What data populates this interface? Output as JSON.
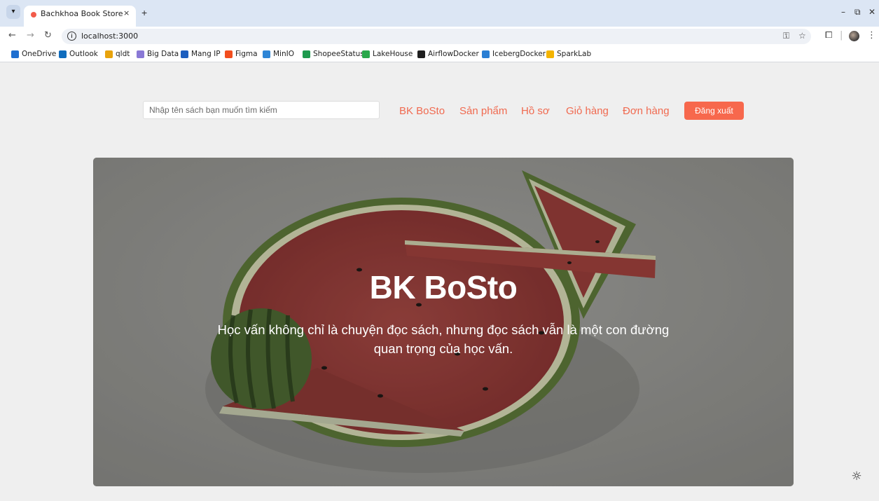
{
  "browser": {
    "tab_title": "Bachkhoa Book Store",
    "tab_close": "×",
    "new_tab": "+",
    "url": "localhost:3000",
    "bookmarks": [
      {
        "label": "OneDrive",
        "icon": "onedrive-icon",
        "color": "#1e6fd0"
      },
      {
        "label": "Outlook",
        "icon": "outlook-icon",
        "color": "#0f6cbd"
      },
      {
        "label": "qldt",
        "icon": "qldt-icon",
        "color": "#e8a30c"
      },
      {
        "label": "Big Data",
        "icon": "spark-icon",
        "color": "#8a79d6"
      },
      {
        "label": "Mang IP",
        "icon": "mangip-icon",
        "color": "#1d5fbf"
      },
      {
        "label": "Figma",
        "icon": "figma-icon",
        "color": "#f24e1e"
      },
      {
        "label": "MinIO",
        "icon": "minio-icon",
        "color": "#2f86d6"
      },
      {
        "label": "ShopeeStatus",
        "icon": "sheets-icon",
        "color": "#1e9a4e"
      },
      {
        "label": "LakeHouse",
        "icon": "lakehouse-icon",
        "color": "#2aa84a"
      },
      {
        "label": "AirflowDocker",
        "icon": "github-icon",
        "color": "#1f1f1f"
      },
      {
        "label": "IcebergDocker",
        "icon": "iceberg-icon",
        "color": "#2a7fd4"
      },
      {
        "label": "SparkLab",
        "icon": "drive-icon",
        "color": "#f4b400"
      }
    ]
  },
  "header": {
    "search_placeholder": "Nhập tên sách bạn muốn tìm kiếm",
    "nav": [
      "BK BoSto",
      "Sản phẩm",
      "Hồ sơ",
      "Giỏ hàng",
      "Đơn hàng"
    ],
    "logout_label": "Đăng xuất",
    "accent_color": "#f7684d"
  },
  "hero": {
    "title": "BK BoSto",
    "subtitle": "Học vấn không chỉ là chuyện đọc sách, nhưng đọc sách vẫn là một con đường quan trọng của học vấn."
  },
  "theme_toggle_icon": "sun-icon"
}
